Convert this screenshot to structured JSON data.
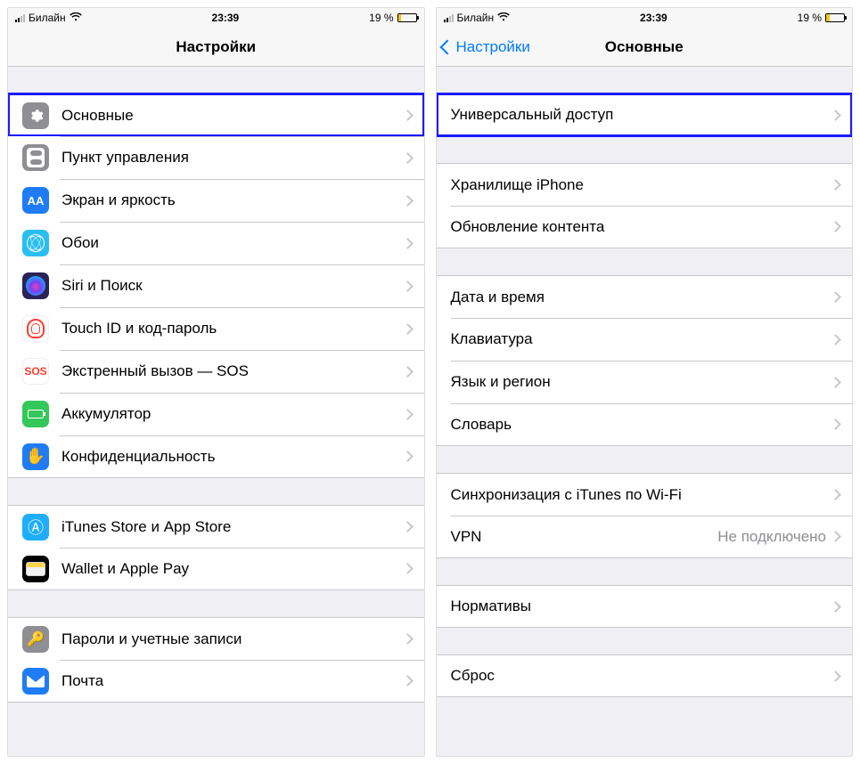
{
  "status": {
    "carrier": "Билайн",
    "time": "23:39",
    "battery_pct": "19 %"
  },
  "left": {
    "title": "Настройки",
    "groups": [
      [
        {
          "id": "general",
          "label": "Основные",
          "icon": "gear",
          "highlight": true
        },
        {
          "id": "control-center",
          "label": "Пункт управления",
          "icon": "cc"
        },
        {
          "id": "display",
          "label": "Экран и яркость",
          "icon": "disp"
        },
        {
          "id": "wallpaper",
          "label": "Обои",
          "icon": "wall"
        },
        {
          "id": "siri",
          "label": "Siri и Поиск",
          "icon": "siri"
        },
        {
          "id": "touchid",
          "label": "Touch ID и код-пароль",
          "icon": "touch"
        },
        {
          "id": "sos",
          "label": "Экстренный вызов — SOS",
          "icon": "sos"
        },
        {
          "id": "battery",
          "label": "Аккумулятор",
          "icon": "batt"
        },
        {
          "id": "privacy",
          "label": "Конфиденциальность",
          "icon": "priv"
        }
      ],
      [
        {
          "id": "appstore",
          "label": "iTunes Store и App Store",
          "icon": "as"
        },
        {
          "id": "wallet",
          "label": "Wallet и Apple Pay",
          "icon": "wallet"
        }
      ],
      [
        {
          "id": "passwords",
          "label": "Пароли и учетные записи",
          "icon": "pass"
        },
        {
          "id": "mail",
          "label": "Почта",
          "icon": "mail"
        }
      ]
    ]
  },
  "right": {
    "back": "Настройки",
    "title": "Основные",
    "groups": [
      [
        {
          "id": "accessibility",
          "label": "Универсальный доступ",
          "highlight": true
        }
      ],
      [
        {
          "id": "storage",
          "label": "Хранилище iPhone"
        },
        {
          "id": "bg-refresh",
          "label": "Обновление контента"
        }
      ],
      [
        {
          "id": "datetime",
          "label": "Дата и время"
        },
        {
          "id": "keyboard",
          "label": "Клавиатура"
        },
        {
          "id": "lang",
          "label": "Язык и регион"
        },
        {
          "id": "dict",
          "label": "Словарь"
        }
      ],
      [
        {
          "id": "itunes-wifi",
          "label": "Синхронизация с iTunes по Wi-Fi"
        },
        {
          "id": "vpn",
          "label": "VPN",
          "value": "Не подключено"
        }
      ],
      [
        {
          "id": "regulatory",
          "label": "Нормативы"
        }
      ],
      [
        {
          "id": "reset",
          "label": "Сброс"
        }
      ]
    ]
  }
}
